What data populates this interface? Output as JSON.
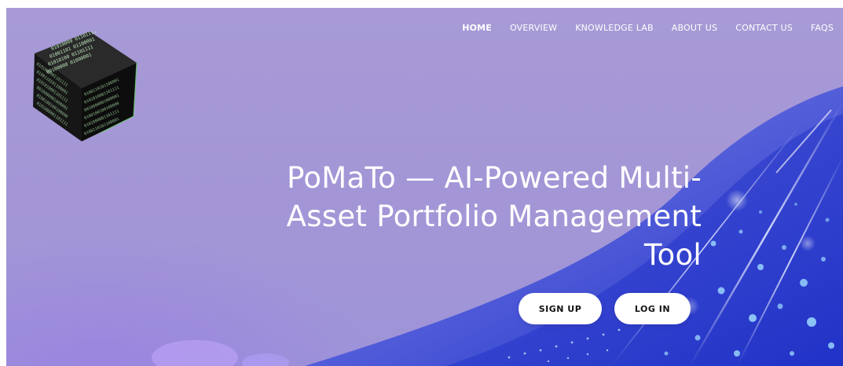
{
  "nav": {
    "items": [
      {
        "label": "HOME",
        "active": true
      },
      {
        "label": "OVERVIEW",
        "active": false
      },
      {
        "label": "KNOWLEDGE LAB",
        "active": false
      },
      {
        "label": "ABOUT US",
        "active": false
      },
      {
        "label": "CONTACT US",
        "active": false
      },
      {
        "label": "FAQS",
        "active": false
      }
    ]
  },
  "hero": {
    "title_line1": "PoMaTo — AI-Powered Multi-",
    "title_line2": "Asset Portfolio Management",
    "title_line3": "Tool",
    "signup_label": "SIGN UP",
    "login_label": "LOG IN"
  },
  "logo": {
    "icon": "binary-data-cube-icon",
    "lines": [
      "01010000 01101111",
      "01001101 01100001",
      "01010100 01101111",
      "00100000 01000001",
      "01001001 00100000"
    ]
  },
  "colors": {
    "background": "#a79ad6",
    "accent_blue": "#3a4fd8",
    "button_bg": "#ffffff",
    "text": "#ffffff"
  }
}
